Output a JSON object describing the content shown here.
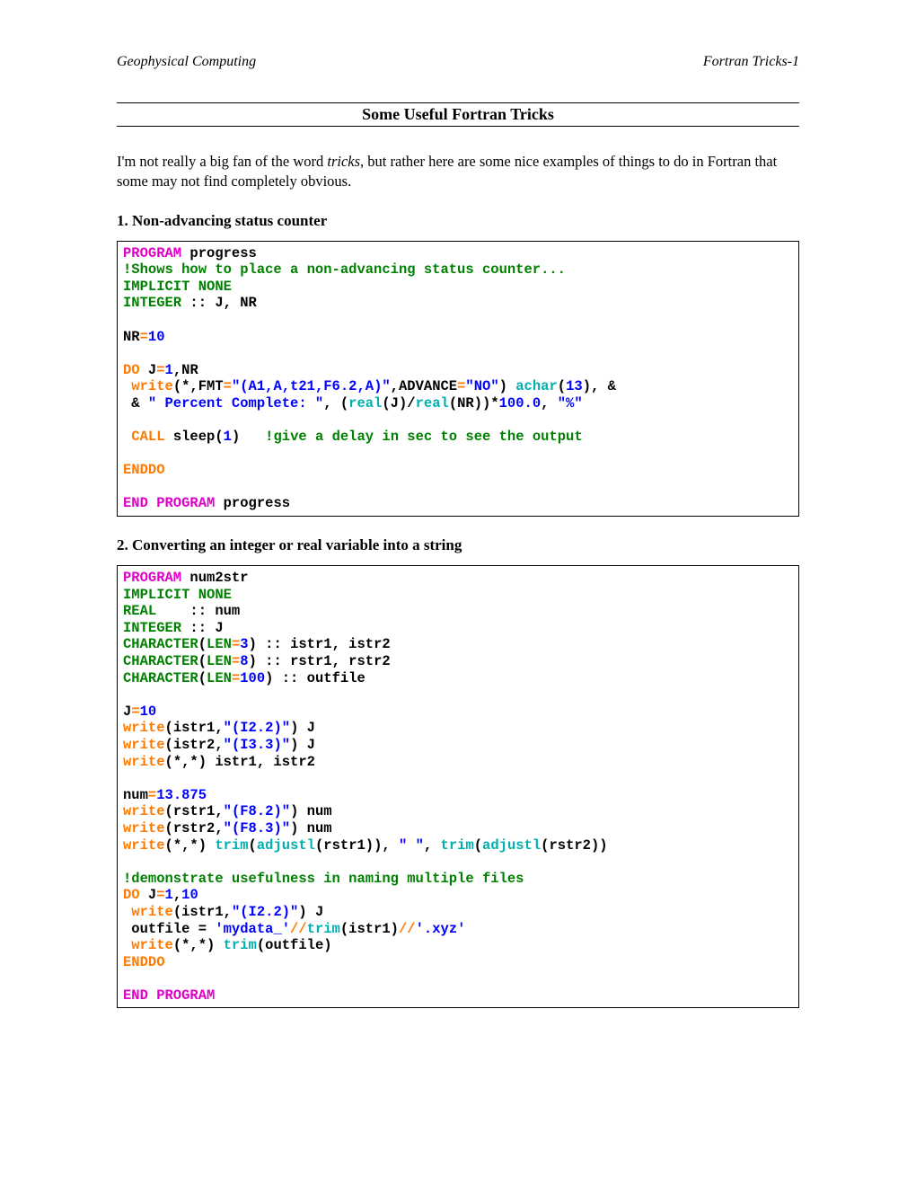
{
  "header": {
    "left": "Geophysical Computing",
    "right": "Fortran Tricks-1"
  },
  "title": "Some Useful Fortran Tricks",
  "intro_a": "I'm not really a big fan of the word ",
  "intro_em": "tricks",
  "intro_b": ", but rather here are some nice examples of things to do in Fortran that some may not find completely obvious.",
  "sec1": "1. Non-advancing status counter",
  "sec2": "2. Converting an integer or real variable into a string",
  "c1": {
    "l1a": "PROGRAM",
    "l1b": " progress",
    "l2": "!Shows how to place a non-advancing status counter...",
    "l3": "IMPLICIT NONE",
    "l4a": "INTEGER",
    "l4b": " :: J, NR",
    "l5": "",
    "l6a": "NR",
    "l6b": "=",
    "l6c": "10",
    "l7": "",
    "l8a": "DO",
    "l8b": " J",
    "l8c": "=",
    "l8d": "1",
    "l8e": ",NR",
    "l9a": " write",
    "l9b": "(*,",
    "l9c": "FMT",
    "l9d": "=",
    "l9e": "\"(A1,A,t21,F6.2,A)\"",
    "l9f": ",",
    "l9g": "ADVANCE",
    "l9h": "=",
    "l9i": "\"NO\"",
    "l9j": ")",
    "l9k": " achar",
    "l9l": "(",
    "l9m": "13",
    "l9n": "), &",
    "l10a": " & ",
    "l10b": "\" Percent Complete: \"",
    "l10c": ", (",
    "l10d": "real",
    "l10e": "(J)/",
    "l10f": "real",
    "l10g": "(NR))*",
    "l10h": "100.0",
    "l10i": ", ",
    "l10j": "\"%\"",
    "l11": "",
    "l12a": " CALL",
    "l12b": " sleep(",
    "l12c": "1",
    "l12d": ")   ",
    "l12e": "!give a delay in sec to see the output",
    "l13": "",
    "l14": "ENDDO",
    "l15": "",
    "l16a": "END PROGRAM",
    "l16b": " progress"
  },
  "c2": {
    "l1a": "PROGRAM",
    "l1b": " num2str",
    "l2": "IMPLICIT NONE",
    "l3a": "REAL",
    "l3b": "    :: num",
    "l4a": "INTEGER",
    "l4b": " :: J",
    "l5a": "CHARACTER",
    "l5b": "(",
    "l5c": "LEN",
    "l5d": "=",
    "l5e": "3",
    "l5f": ") :: istr1, istr2",
    "l6a": "CHARACTER",
    "l6b": "(",
    "l6c": "LEN",
    "l6d": "=",
    "l6e": "8",
    "l6f": ") :: rstr1, rstr2",
    "l7a": "CHARACTER",
    "l7b": "(",
    "l7c": "LEN",
    "l7d": "=",
    "l7e": "100",
    "l7f": ") :: outfile",
    "l8": "",
    "l9a": "J",
    "l9b": "=",
    "l9c": "10",
    "l10a": "write",
    "l10b": "(istr1,",
    "l10c": "\"(I2.2)\"",
    "l10d": ") J",
    "l11a": "write",
    "l11b": "(istr2,",
    "l11c": "\"(I3.3)\"",
    "l11d": ") J",
    "l12a": "write",
    "l12b": "(*,*) istr1, istr2",
    "l13": "",
    "l14a": "num",
    "l14b": "=",
    "l14c": "13.875",
    "l15a": "write",
    "l15b": "(rstr1,",
    "l15c": "\"(F8.2)\"",
    "l15d": ") num",
    "l16a": "write",
    "l16b": "(rstr2,",
    "l16c": "\"(F8.3)\"",
    "l16d": ") num",
    "l17a": "write",
    "l17b": "(*,*) ",
    "l17c": "trim",
    "l17d": "(",
    "l17e": "adjustl",
    "l17f": "(rstr1)), ",
    "l17g": "\" \"",
    "l17h": ", ",
    "l17i": "trim",
    "l17j": "(",
    "l17k": "adjustl",
    "l17l": "(rstr2))",
    "l18": "",
    "l19": "!demonstrate usefulness in naming multiple files",
    "l20a": "DO",
    "l20b": " J",
    "l20c": "=",
    "l20d": "1",
    "l20e": ",",
    "l20f": "10",
    "l21a": " write",
    "l21b": "(istr1,",
    "l21c": "\"(I2.2)\"",
    "l21d": ") J",
    "l22a": " outfile = ",
    "l22b": "'mydata_'",
    "l22c": "//",
    "l22d": "trim",
    "l22e": "(istr1)",
    "l22f": "//",
    "l22g": "'.xyz'",
    "l23a": " write",
    "l23b": "(*,*) ",
    "l23c": "trim",
    "l23d": "(outfile)",
    "l24": "ENDDO",
    "l25": "",
    "l26": "END PROGRAM"
  }
}
